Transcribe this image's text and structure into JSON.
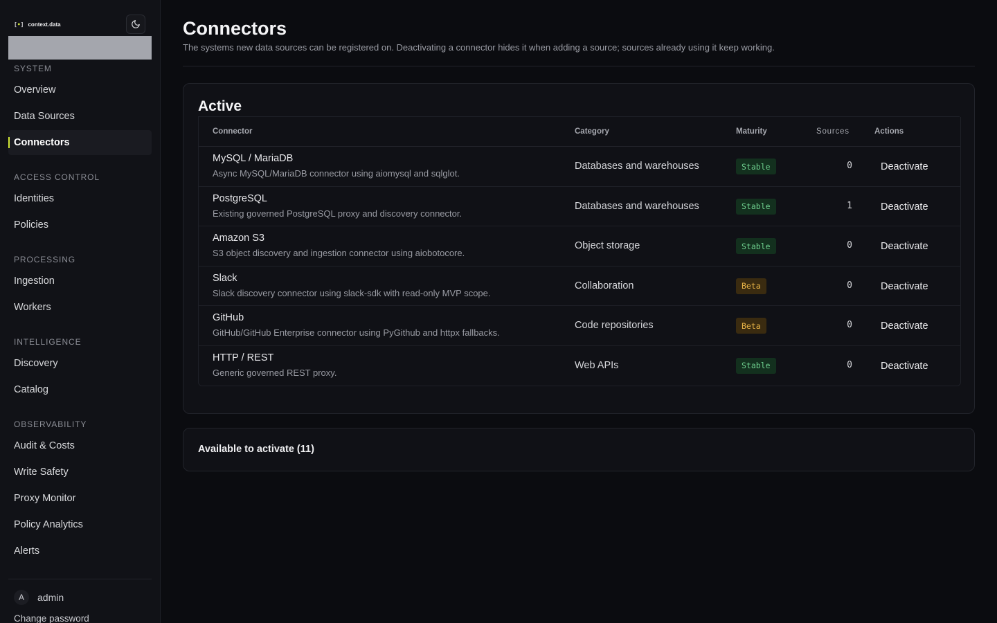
{
  "brand": {
    "name": "context.data",
    "mark": "[•]"
  },
  "theme_toggle": {
    "icon": "moon-icon"
  },
  "sidebar": {
    "sections": [
      {
        "label": "SYSTEM",
        "items": [
          "Overview",
          "Data Sources",
          "Connectors"
        ]
      },
      {
        "label": "ACCESS CONTROL",
        "items": [
          "Identities",
          "Policies"
        ]
      },
      {
        "label": "PROCESSING",
        "items": [
          "Ingestion",
          "Workers"
        ]
      },
      {
        "label": "INTELLIGENCE",
        "items": [
          "Discovery",
          "Catalog"
        ]
      },
      {
        "label": "OBSERVABILITY",
        "items": [
          "Audit & Costs",
          "Write Safety",
          "Proxy Monitor",
          "Policy Analytics",
          "Alerts"
        ]
      }
    ],
    "active_item": "Connectors",
    "user": {
      "initial": "A",
      "name": "admin"
    },
    "change_password": "Change password"
  },
  "page": {
    "title": "Connectors",
    "subtitle": "The systems new data sources can be registered on. Deactivating a connector hides it when adding a source; sources already using it keep working."
  },
  "active_card": {
    "title": "Active",
    "columns": {
      "connector": "Connector",
      "category": "Category",
      "maturity": "Maturity",
      "sources": "Sources",
      "actions": "Actions"
    },
    "rows": [
      {
        "name": "MySQL / MariaDB",
        "description": "Async MySQL/MariaDB connector using aiomysql and sqlglot.",
        "category": "Databases and warehouses",
        "maturity": "Stable",
        "sources": "0",
        "action": "Deactivate"
      },
      {
        "name": "PostgreSQL",
        "description": "Existing governed PostgreSQL proxy and discovery connector.",
        "category": "Databases and warehouses",
        "maturity": "Stable",
        "sources": "1",
        "action": "Deactivate"
      },
      {
        "name": "Amazon S3",
        "description": "S3 object discovery and ingestion connector using aiobotocore.",
        "category": "Object storage",
        "maturity": "Stable",
        "sources": "0",
        "action": "Deactivate"
      },
      {
        "name": "Slack",
        "description": "Slack discovery connector using slack-sdk with read-only MVP scope.",
        "category": "Collaboration",
        "maturity": "Beta",
        "sources": "0",
        "action": "Deactivate"
      },
      {
        "name": "GitHub",
        "description": "GitHub/GitHub Enterprise connector using PyGithub and httpx fallbacks.",
        "category": "Code repositories",
        "maturity": "Beta",
        "sources": "0",
        "action": "Deactivate"
      },
      {
        "name": "HTTP / REST",
        "description": "Generic governed REST proxy.",
        "category": "Web APIs",
        "maturity": "Stable",
        "sources": "0",
        "action": "Deactivate"
      }
    ]
  },
  "available_card": {
    "title": "Available to activate (11)"
  },
  "colors": {
    "accent": "#d4e836",
    "stable": "#6fd08f",
    "beta": "#e8b447",
    "background": "#0b0c10"
  }
}
